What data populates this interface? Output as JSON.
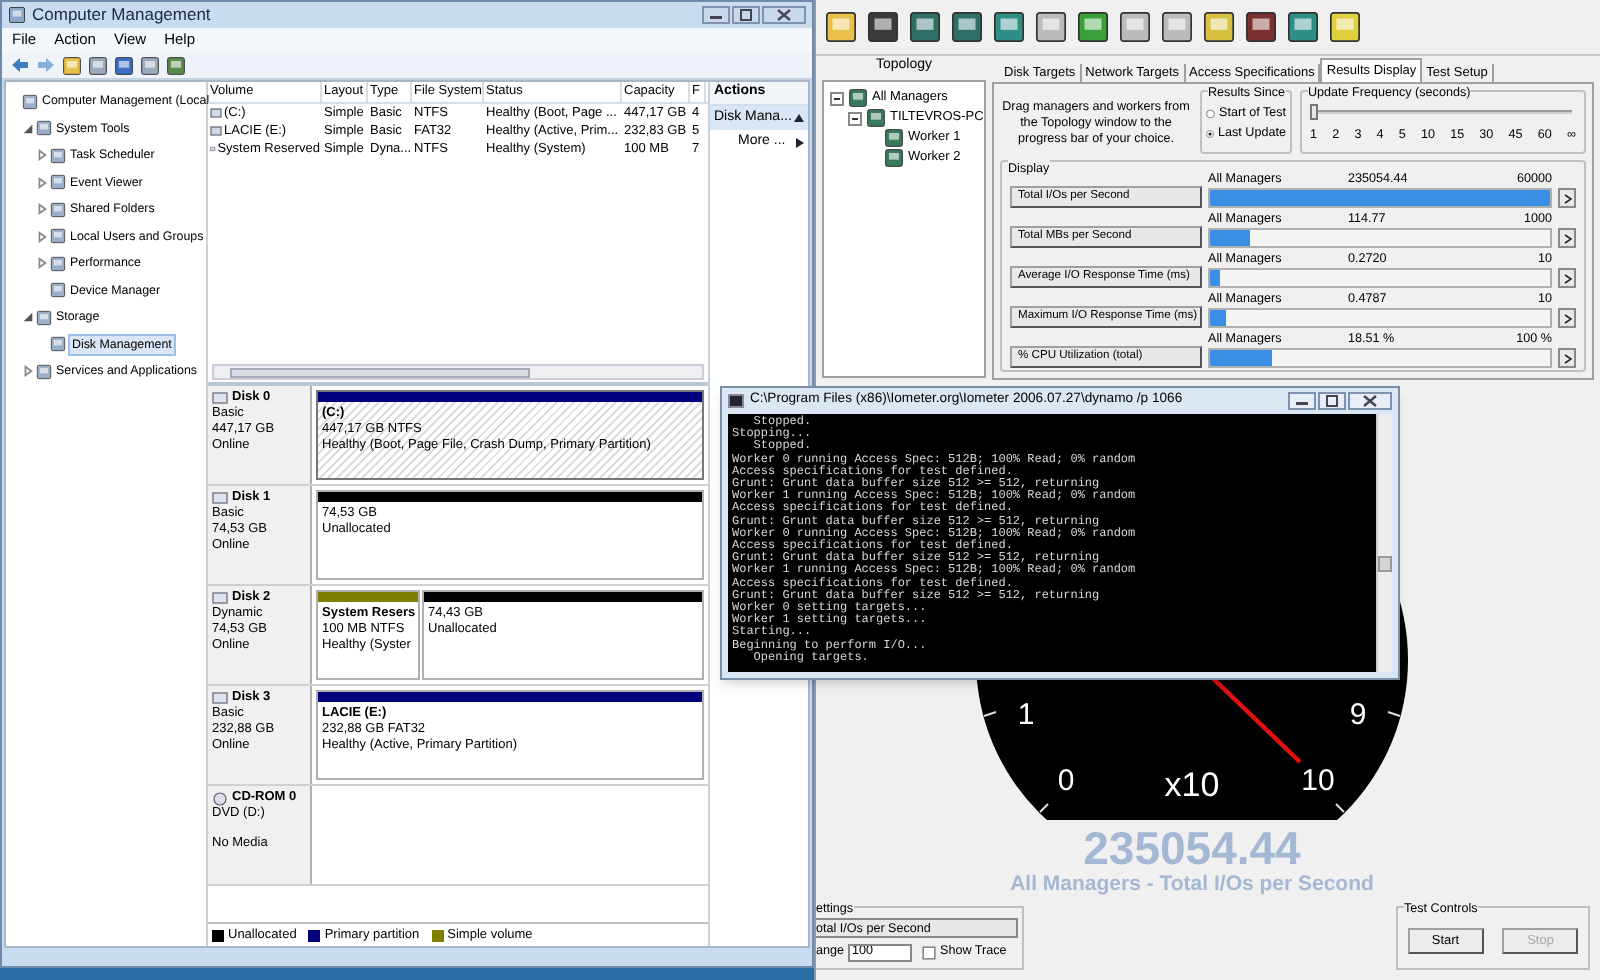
{
  "computer_management": {
    "title": "Computer Management",
    "menu": [
      "File",
      "Action",
      "View",
      "Help"
    ],
    "tree": [
      {
        "label": "Computer Management (Local",
        "selected": false,
        "children": [
          {
            "label": "System Tools",
            "selected": false,
            "expanded": true,
            "children": [
              {
                "label": "Task Scheduler",
                "selected": false,
                "expanded": false
              },
              {
                "label": "Event Viewer",
                "selected": false,
                "expanded": false
              },
              {
                "label": "Shared Folders",
                "selected": false,
                "expanded": false
              },
              {
                "label": "Local Users and Groups",
                "selected": false,
                "expanded": false
              },
              {
                "label": "Performance",
                "selected": false,
                "expanded": false
              },
              {
                "label": "Device Manager",
                "selected": false
              }
            ]
          },
          {
            "label": "Storage",
            "selected": false,
            "expanded": true,
            "children": [
              {
                "label": "Disk Management",
                "selected": true
              }
            ]
          },
          {
            "label": "Services and Applications",
            "selected": false,
            "expanded": false
          }
        ]
      }
    ],
    "volume_table": {
      "columns": [
        "Volume",
        "Layout",
        "Type",
        "File System",
        "Status",
        "Capacity",
        "F"
      ],
      "rows": [
        [
          "(C:)",
          "Simple",
          "Basic",
          "NTFS",
          "Healthy (Boot, Page ...",
          "447,17 GB",
          "4"
        ],
        [
          "LACIE (E:)",
          "Simple",
          "Basic",
          "FAT32",
          "Healthy (Active, Prim...",
          "232,83 GB",
          "5"
        ],
        [
          "System Reserved",
          "Simple",
          "Dyna...",
          "NTFS",
          "Healthy (System)",
          "100 MB",
          "7"
        ]
      ]
    },
    "actions": {
      "title": "Actions",
      "items": [
        {
          "label": "Disk Mana...",
          "kind": "header"
        },
        {
          "label": "More ...",
          "kind": "link"
        }
      ]
    },
    "disks": [
      {
        "name": "Disk 0",
        "kind": "disk",
        "lines": [
          "Basic",
          "447,17 GB",
          "Online"
        ],
        "partitions": [
          {
            "kind": "primary",
            "selected": true,
            "lines": [
              "(C:)",
              "447,17 GB NTFS",
              "Healthy (Boot, Page File, Crash Dump, Primary Partition)"
            ]
          }
        ]
      },
      {
        "name": "Disk 1",
        "kind": "disk",
        "lines": [
          "Basic",
          "74,53 GB",
          "Online"
        ],
        "partitions": [
          {
            "kind": "unallocated",
            "selected": false,
            "lines": [
              "74,53 GB",
              "Unallocated"
            ]
          }
        ]
      },
      {
        "name": "Disk 2",
        "kind": "disk",
        "lines": [
          "Dynamic",
          "74,53 GB",
          "Online"
        ],
        "partitions": [
          {
            "kind": "simple",
            "selected": false,
            "lines": [
              "System Resers",
              "100 MB NTFS",
              "Healthy (Syster"
            ]
          },
          {
            "kind": "unallocated",
            "selected": false,
            "lines": [
              "74,43 GB",
              "Unallocated"
            ]
          }
        ]
      },
      {
        "name": "Disk 3",
        "kind": "disk",
        "lines": [
          "Basic",
          "232,88 GB",
          "Online"
        ],
        "partitions": [
          {
            "kind": "primary",
            "selected": false,
            "lines": [
              "LACIE  (E:)",
              "232,88 GB FAT32",
              "Healthy (Active, Primary Partition)"
            ]
          }
        ]
      },
      {
        "name": "CD-ROM 0",
        "kind": "cdrom",
        "lines": [
          "DVD (D:)",
          "No Media"
        ]
      }
    ],
    "legend": [
      {
        "label": "Unallocated",
        "color": "#000000"
      },
      {
        "label": "Primary partition",
        "color": "#00007f"
      },
      {
        "label": "Simple volume",
        "color": "#808000"
      }
    ]
  },
  "iometer": {
    "topology": {
      "title": "Topology",
      "tree": [
        {
          "label": "All Managers",
          "expanded": true,
          "children": [
            {
              "label": "TILTEVROS-PC",
              "expanded": true,
              "children": [
                {
                  "label": "Worker 1"
                },
                {
                  "label": "Worker 2"
                }
              ]
            }
          ]
        }
      ]
    },
    "tabs": [
      {
        "label": "Disk Targets",
        "selected": false
      },
      {
        "label": "Network Targets",
        "selected": false
      },
      {
        "label": "Access Specifications",
        "selected": false
      },
      {
        "label": "Results Display",
        "selected": true
      },
      {
        "label": "Test Setup",
        "selected": false
      }
    ],
    "hint": "Drag managers and workers from the Topology window to the progress bar of your choice.",
    "results_since": {
      "title": "Results Since",
      "options": [
        {
          "label": "Start of Test",
          "selected": false
        },
        {
          "label": "Last Update",
          "selected": true
        }
      ]
    },
    "update_frequency": {
      "title": "Update Frequency (seconds)",
      "level": 0,
      "ticks": [
        "1",
        "2",
        "3",
        "4",
        "5",
        "10",
        "15",
        "30",
        "45",
        "60",
        "∞"
      ]
    },
    "display": {
      "title": "Display",
      "rows": [
        {
          "label": "Total I/Os per Second",
          "source": "All Managers",
          "value": "235054.44",
          "max": "60000",
          "level": 1
        },
        {
          "label": "Total MBs per Second",
          "source": "All Managers",
          "value": "114.77",
          "max": "1000",
          "level": 0.115
        },
        {
          "label": "Average I/O Response Time (ms)",
          "source": "All Managers",
          "value": "0.2720",
          "max": "10",
          "level": 0.027
        },
        {
          "label": "Maximum I/O Response Time (ms)",
          "source": "All Managers",
          "value": "0.4787",
          "max": "10",
          "level": 0.048
        },
        {
          "label": "% CPU Utilization (total)",
          "source": "All Managers",
          "value": "18.51 %",
          "max": "100 %",
          "level": 0.185
        }
      ]
    },
    "gauge": {
      "scale_labels": [
        "1",
        "9",
        "0",
        "10"
      ],
      "multiplier": "x10",
      "value": "235054.44",
      "caption": "All Managers - Total I/Os per Second"
    },
    "settings": {
      "title": "ettings",
      "metric": "otal I/Os per Second",
      "range_label": "ange",
      "range_value": "100",
      "show_trace": {
        "label": "Show Trace",
        "checked": false
      }
    },
    "test_controls": {
      "title": "Test Controls",
      "buttons": [
        {
          "label": "Start",
          "disabled": false
        },
        {
          "label": "Stop",
          "disabled": true
        }
      ]
    }
  },
  "console": {
    "title": "C:\\Program Files (x86)\\Iometer.org\\Iometer 2006.07.27\\dynamo /p 1066",
    "lines": [
      "   Stopped.",
      "Stopping...",
      "   Stopped.",
      "Worker 0 running Access Spec: 512B; 100% Read; 0% random",
      "Access specifications for test defined.",
      "Grunt: Grunt data buffer size 512 >= 512, returning",
      "Worker 1 running Access Spec: 512B; 100% Read; 0% random",
      "Access specifications for test defined.",
      "Grunt: Grunt data buffer size 512 >= 512, returning",
      "Worker 0 running Access Spec: 512B; 100% Read; 0% random",
      "Access specifications for test defined.",
      "Grunt: Grunt data buffer size 512 >= 512, returning",
      "Worker 1 running Access Spec: 512B; 100% Read; 0% random",
      "Access specifications for test defined.",
      "Grunt: Grunt data buffer size 512 >= 512, returning",
      "Worker 0 setting targets...",
      "Worker 1 setting targets...",
      "Starting...",
      "Beginning to perform I/O...",
      "   Opening targets."
    ]
  }
}
